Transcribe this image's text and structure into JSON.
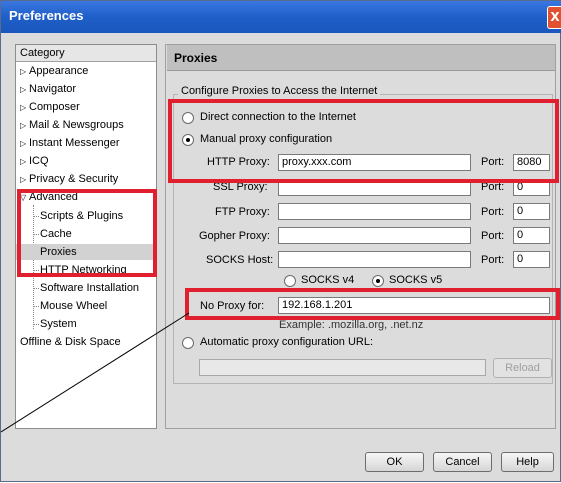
{
  "window": {
    "title": "Preferences",
    "close_label": "X"
  },
  "category": {
    "header": "Category",
    "items": [
      {
        "label": "Appearance"
      },
      {
        "label": "Navigator"
      },
      {
        "label": "Composer"
      },
      {
        "label": "Mail & Newsgroups"
      },
      {
        "label": "Instant Messenger"
      },
      {
        "label": "ICQ"
      },
      {
        "label": "Privacy & Security"
      },
      {
        "label": "Advanced"
      },
      {
        "label": "Scripts & Plugins"
      },
      {
        "label": "Cache"
      },
      {
        "label": "Proxies"
      },
      {
        "label": "HTTP Networking"
      },
      {
        "label": "Software Installation"
      },
      {
        "label": "Mouse Wheel"
      },
      {
        "label": "System"
      },
      {
        "label": "Offline & Disk Space"
      }
    ]
  },
  "panel": {
    "title": "Proxies",
    "group_label": "Configure Proxies to Access the Internet",
    "direct_label": "Direct connection to the Internet",
    "manual_label": "Manual proxy configuration",
    "http_label": "HTTP Proxy:",
    "http_value": "proxy.xxx.com",
    "ssl_label": "SSL Proxy:",
    "ssl_value": "",
    "ftp_label": "FTP Proxy:",
    "ftp_value": "",
    "gopher_label": "Gopher Proxy:",
    "gopher_value": "",
    "socks_label": "SOCKS Host:",
    "socks_value": "",
    "port_label": "Port:",
    "http_port": "8080",
    "ssl_port": "0",
    "ftp_port": "0",
    "gopher_port": "0",
    "socks_port": "0",
    "socks4_label": "SOCKS v4",
    "socks5_label": "SOCKS v5",
    "noproxy_label": "No Proxy for:",
    "noproxy_value": "192.168.1.201",
    "example_text": "Example: .mozilla.org, .net.nz",
    "auto_label": "Automatic proxy configuration URL:",
    "auto_value": "",
    "reload_label": "Reload"
  },
  "buttons": {
    "ok": "OK",
    "cancel": "Cancel",
    "help": "Help"
  },
  "colors": {
    "highlight_box": "#e01f2f",
    "titlebar": "#2a66d6"
  }
}
